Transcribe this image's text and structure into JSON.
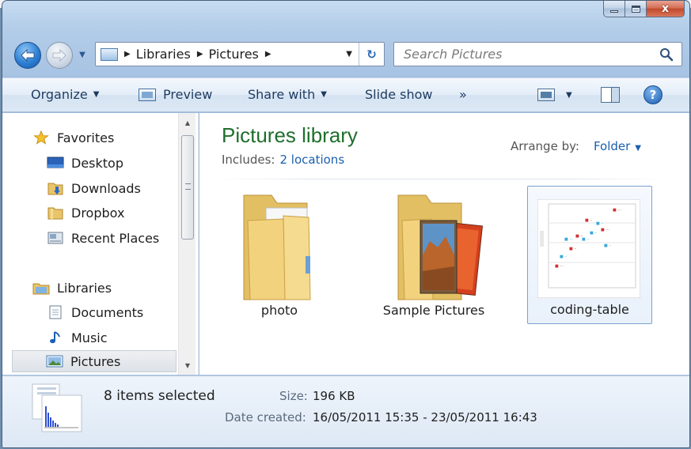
{
  "window": {
    "caption": {
      "minimize": "minimize",
      "maximize": "maximize",
      "close": "x"
    }
  },
  "navigation": {
    "breadcrumb": [
      "Libraries",
      "Pictures"
    ],
    "search_placeholder": "Search Pictures"
  },
  "toolbar": {
    "organize": "Organize",
    "preview": "Preview",
    "share_with": "Share with",
    "slide_show": "Slide show",
    "overflow": "»"
  },
  "sidebar": {
    "favorites_header": "Favorites",
    "favorites": [
      "Desktop",
      "Downloads",
      "Dropbox",
      "Recent Places"
    ],
    "libraries_header": "Libraries",
    "libraries": [
      "Documents",
      "Music",
      "Pictures"
    ]
  },
  "library": {
    "title": "Pictures library",
    "includes_label": "Includes:",
    "includes_link": "2 locations",
    "arrange_label": "Arrange by:",
    "arrange_value": "Folder"
  },
  "items": [
    {
      "name": "photo",
      "kind": "folder",
      "selected": false
    },
    {
      "name": "Sample Pictures",
      "kind": "folder",
      "selected": false
    },
    {
      "name": "coding-table",
      "kind": "image",
      "selected": true
    }
  ],
  "details": {
    "count": "8 items selected",
    "size_label": "Size:",
    "size_value": "196 KB",
    "date_label": "Date created:",
    "date_value": "16/05/2011 15:35 - 23/05/2011 16:43"
  },
  "colors": {
    "library_title": "#1f6e2d",
    "link": "#1a5fad",
    "selection_border": "#7da2ce"
  }
}
